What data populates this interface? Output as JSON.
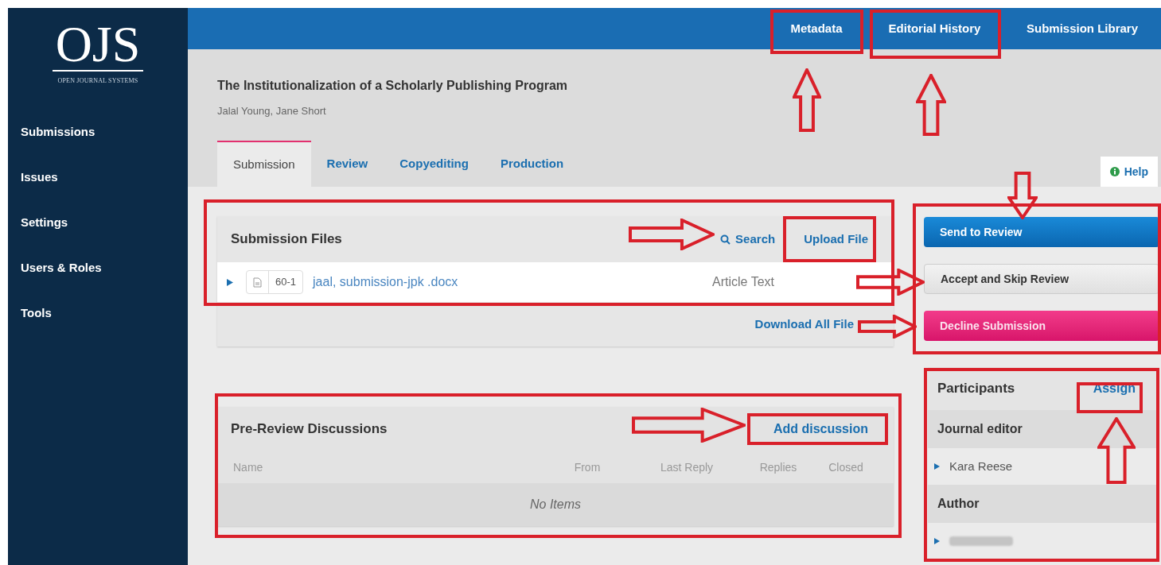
{
  "sidebar": {
    "logo": {
      "wordmark": "OJS",
      "tagline": "OPEN JOURNAL SYSTEMS"
    },
    "items": [
      {
        "label": "Submissions"
      },
      {
        "label": "Issues"
      },
      {
        "label": "Settings"
      },
      {
        "label": "Users & Roles"
      },
      {
        "label": "Tools"
      }
    ]
  },
  "top_nav": [
    {
      "label": "Metadata"
    },
    {
      "label": "Editorial History"
    },
    {
      "label": "Submission Library"
    }
  ],
  "submission": {
    "title": "The Institutionalization of a Scholarly Publishing Program",
    "authors": "Jalal Young, Jane Short"
  },
  "tabs": [
    {
      "label": "Submission",
      "selected": true
    },
    {
      "label": "Review",
      "selected": false
    },
    {
      "label": "Copyediting",
      "selected": false
    },
    {
      "label": "Production",
      "selected": false
    }
  ],
  "help": {
    "label": "Help"
  },
  "submission_files": {
    "title": "Submission Files",
    "search": "Search",
    "upload": "Upload File",
    "files": [
      {
        "id": "60-1",
        "name": "jaal, submission-jpk .docx",
        "type": "Article Text"
      }
    ],
    "download_all": "Download All File"
  },
  "actions": [
    {
      "label": "Send to Review",
      "kind": "primary"
    },
    {
      "label": "Accept and Skip Review",
      "kind": "default"
    },
    {
      "label": "Decline Submission",
      "kind": "danger"
    }
  ],
  "discussions": {
    "title": "Pre-Review Discussions",
    "add": "Add discussion",
    "columns": [
      "Name",
      "From",
      "Last Reply",
      "Replies",
      "Closed"
    ],
    "empty": "No Items"
  },
  "participants": {
    "title": "Participants",
    "assign": "Assign",
    "groups": [
      {
        "role": "Journal editor",
        "members": [
          {
            "kind": "name",
            "name": "Kara Reese"
          }
        ]
      },
      {
        "role": "Author",
        "members": [
          {
            "kind": "redacted"
          }
        ]
      }
    ]
  }
}
